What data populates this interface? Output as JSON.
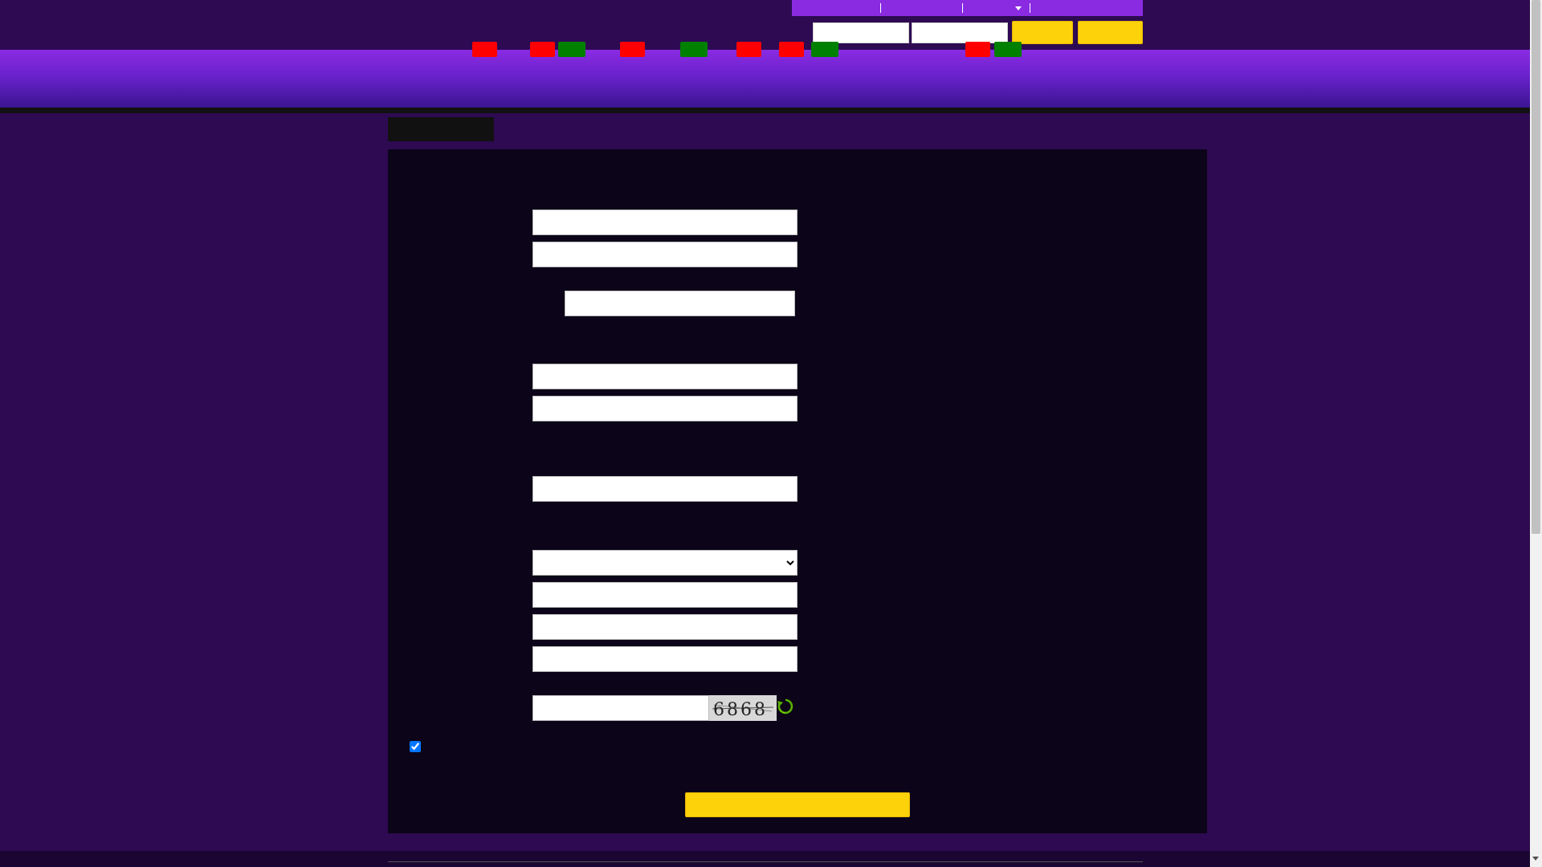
{
  "header": {
    "top_links": [
      "",
      "",
      "",
      ""
    ],
    "login": {
      "username_placeholder": "",
      "password_placeholder": "",
      "login_label": "",
      "register_label": ""
    }
  },
  "nav": {
    "badges": [
      {
        "label": "",
        "color": "#ff0000"
      },
      {
        "label": "",
        "color": "#ff0000"
      },
      {
        "label": "",
        "color": "#008000"
      },
      {
        "label": "",
        "color": "#ff0000"
      },
      {
        "label": "",
        "color": "#008000"
      },
      {
        "label": "",
        "color": "#ff0000"
      },
      {
        "label": "",
        "color": "#ff0000"
      },
      {
        "label": "",
        "color": "#008000"
      },
      {
        "label": "",
        "color": "#ff0000"
      },
      {
        "label": "",
        "color": "#008000"
      }
    ]
  },
  "page": {
    "title": ""
  },
  "form": {
    "fields": [
      {
        "name": "field-1",
        "value": ""
      },
      {
        "name": "field-2",
        "value": ""
      },
      {
        "name": "field-3",
        "value": ""
      },
      {
        "name": "field-4",
        "value": ""
      },
      {
        "name": "field-5",
        "value": ""
      },
      {
        "name": "field-6",
        "value": ""
      },
      {
        "name": "select-1",
        "value": ""
      },
      {
        "name": "field-7",
        "value": ""
      },
      {
        "name": "field-8",
        "value": ""
      },
      {
        "name": "field-9",
        "value": ""
      }
    ],
    "captcha": {
      "input_value": "",
      "code": "6868",
      "refresh_icon": "refresh-icon"
    },
    "agree_checked": true,
    "submit_label": ""
  },
  "colors": {
    "background": "#2d0a52",
    "panel": "#0c0418",
    "accent_purple": "#8a2be2",
    "accent_yellow": "#fdd20a",
    "badge_red": "#ff0000",
    "badge_green": "#008000"
  }
}
